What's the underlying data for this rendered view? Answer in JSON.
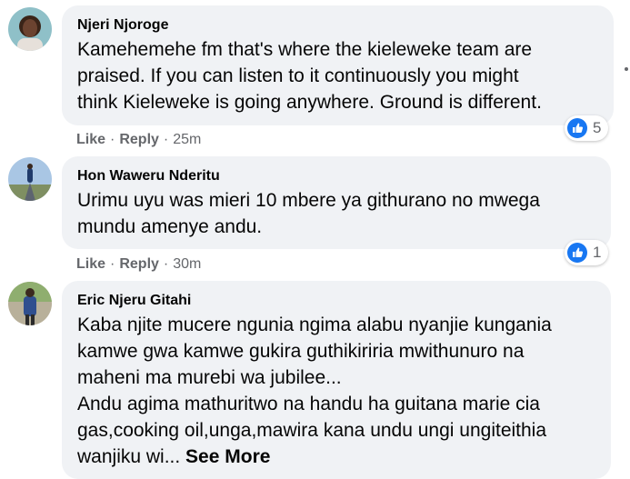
{
  "comments": [
    {
      "author": "Njeri Njoroge",
      "text": "Kamehemehe fm that's where the kieleweke team are\npraised. If you can listen to it continuously you might\nthink Kieleweke is going anywhere. Ground is different.",
      "like_label": "Like",
      "reply_label": "Reply",
      "time": "25m",
      "reaction_count": "5"
    },
    {
      "author": "Hon Waweru Nderitu",
      "text": "Urimu uyu was mieri 10 mbere ya githurano no mwega\nmundu amenye andu.",
      "like_label": "Like",
      "reply_label": "Reply",
      "time": "30m",
      "reaction_count": "1"
    },
    {
      "author": "Eric Njeru Gitahi",
      "text": "Kaba njite mucere ngunia ngima alabu nyanjie kungania\nkamwe gwa kamwe gukira guthikiriria mwithunuro na\nmaheni ma murebi wa jubilee...\nAndu agima mathuritwo na handu ha guitana marie cia\ngas,cooking oil,unga,mawira kana undu ungi ungiteithia\nwanjiku wi...",
      "see_more": "See More"
    }
  ],
  "separator": "·",
  "icons": {
    "reaction": "like-thumb-icon",
    "options": "more-options-icon"
  },
  "colors": {
    "bubble": "#f0f2f5",
    "like_blue": "#1877f2",
    "meta_gray": "#65676b"
  }
}
